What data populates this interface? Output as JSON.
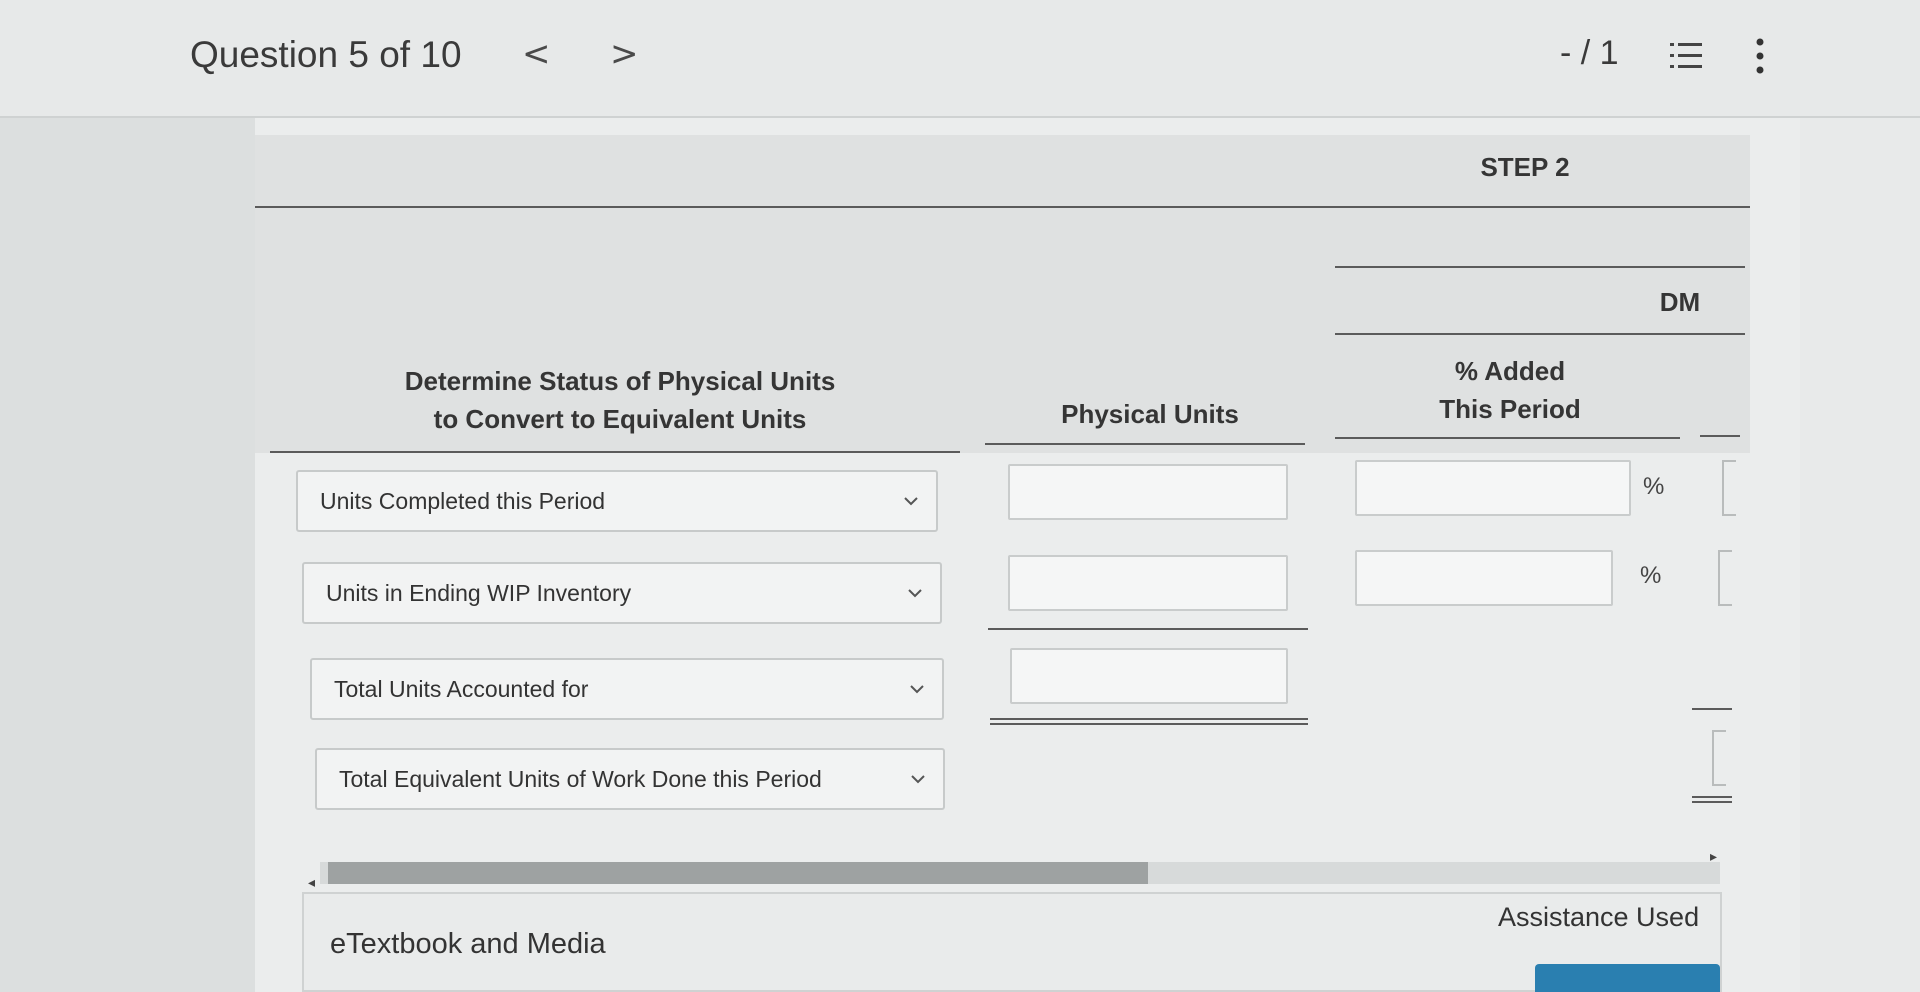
{
  "header": {
    "question_label": "Question 5 of 10",
    "prev_arrow": "<",
    "next_arrow": ">",
    "score": "- / 1",
    "icons": {
      "list": "list-icon",
      "more": "kebab-icon"
    }
  },
  "table": {
    "step_label": "STEP 2",
    "dm_label": "DM",
    "status_header": [
      "Determine Status of Physical Units",
      "to Convert to Equivalent Units"
    ],
    "physical_units_header": "Physical Units",
    "pct_added_header": [
      "% Added",
      "This Period"
    ],
    "percent_sign": "%",
    "rows": [
      {
        "label": "Units Completed this Period",
        "physical_value": "",
        "pct_value": ""
      },
      {
        "label": "Units in Ending WIP Inventory",
        "physical_value": "",
        "pct_value": ""
      },
      {
        "label": "Total Units Accounted for",
        "physical_value": ""
      },
      {
        "label": "Total Equivalent Units of Work Done this Period"
      }
    ]
  },
  "footer": {
    "etextbook_label": "eTextbook and Media",
    "assistance_label": "Assistance Used"
  },
  "colors": {
    "accent": "#2a7fb0",
    "background": "#e4e6e6",
    "header_band": "#dfe1e1"
  }
}
